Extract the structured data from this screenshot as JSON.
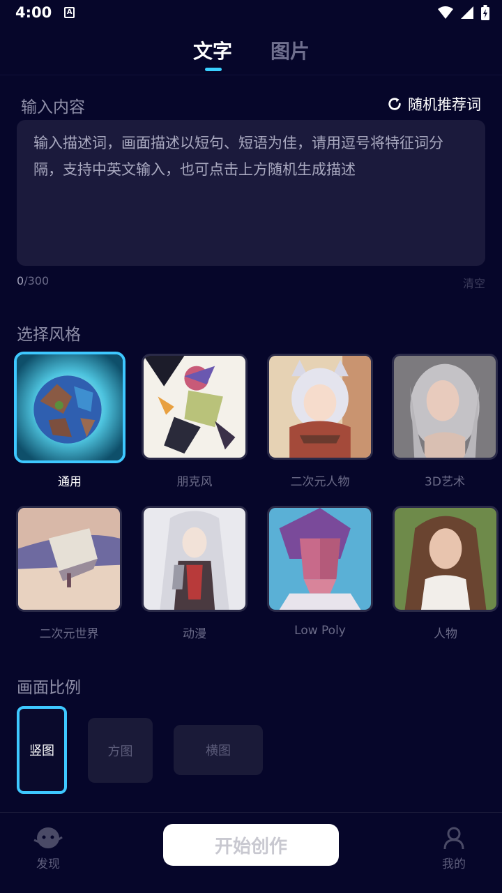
{
  "status": {
    "time": "4:00",
    "badge": "A"
  },
  "tabs": [
    {
      "label": "文字",
      "active": true
    },
    {
      "label": "图片",
      "active": false
    }
  ],
  "input": {
    "section_label": "输入内容",
    "random_label": "随机推荐词",
    "placeholder": "输入描述词，画面描述以短句、短语为佳，请用逗号将特征词分隔，支持中英文输入，也可点击上方随机生成描述",
    "count_current": "0",
    "count_max": "/300",
    "clear_label": "清空"
  },
  "style": {
    "section_label": "选择风格",
    "items": [
      {
        "label": "通用",
        "selected": true
      },
      {
        "label": "朋克风",
        "selected": false
      },
      {
        "label": "二次元人物",
        "selected": false
      },
      {
        "label": "3D艺术",
        "selected": false
      },
      {
        "label": "二次元世界",
        "selected": false
      },
      {
        "label": "动漫",
        "selected": false
      },
      {
        "label": "Low Poly",
        "selected": false
      },
      {
        "label": "人物",
        "selected": false
      }
    ]
  },
  "ratio": {
    "section_label": "画面比例",
    "options": [
      {
        "label": "竖图",
        "selected": true
      },
      {
        "label": "方图",
        "selected": false
      },
      {
        "label": "横图",
        "selected": false
      }
    ]
  },
  "bottom_nav": {
    "discover_label": "发现",
    "start_label": "开始创作",
    "mine_label": "我的"
  },
  "colors": {
    "accent": "#3ec8ff",
    "background": "#06062a",
    "card": "#1b1a3c"
  }
}
